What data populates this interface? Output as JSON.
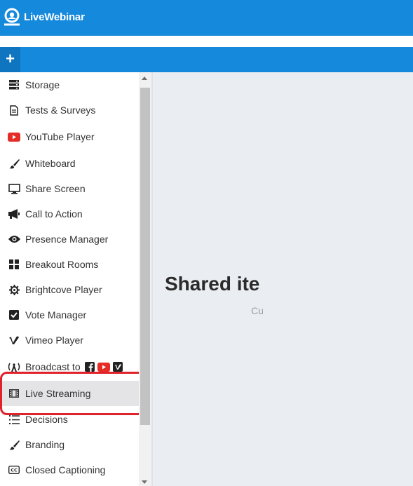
{
  "app": {
    "name": "LiveWebinar"
  },
  "toolbar": {
    "add_label": "+"
  },
  "sidebar": {
    "items": [
      {
        "label": "Storage",
        "icon": "storage-icon"
      },
      {
        "label": "Tests & Surveys",
        "icon": "document-icon"
      },
      {
        "label": "YouTube Player",
        "icon": "youtube-icon"
      },
      {
        "label": "Whiteboard",
        "icon": "brush-icon"
      },
      {
        "label": "Share Screen",
        "icon": "monitor-icon"
      },
      {
        "label": "Call to Action",
        "icon": "megaphone-icon"
      },
      {
        "label": "Presence Manager",
        "icon": "eye-icon"
      },
      {
        "label": "Breakout Rooms",
        "icon": "grid-icon"
      },
      {
        "label": "Brightcove Player",
        "icon": "gear-icon"
      },
      {
        "label": "Vote Manager",
        "icon": "checkbox-icon"
      },
      {
        "label": "Vimeo Player",
        "icon": "vimeo-icon"
      },
      {
        "label": "Broadcast to",
        "icon": "broadcast-icon"
      },
      {
        "label": "Live Streaming",
        "icon": "film-icon"
      },
      {
        "label": "Decisions",
        "icon": "list-icon"
      },
      {
        "label": "Branding",
        "icon": "brush-icon"
      },
      {
        "label": "Closed Captioning",
        "icon": "cc-icon"
      }
    ]
  },
  "main": {
    "title": "Shared ite",
    "subtitle": "Cu"
  },
  "colors": {
    "brand": "#1589dc",
    "highlight": "#e0232a",
    "youtube": "#e52d27"
  }
}
